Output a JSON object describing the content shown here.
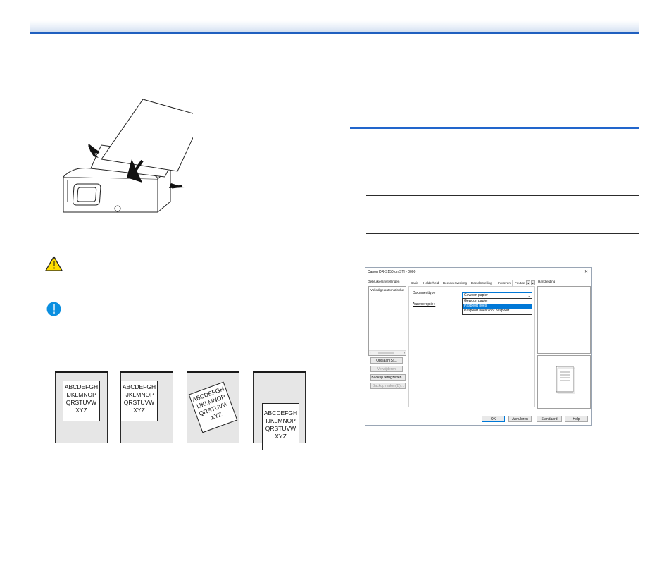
{
  "samples": {
    "lines": [
      "ABCDEFGH",
      "IJKLMNOP",
      "QRSTUVW",
      "XYZ"
    ]
  },
  "dialog": {
    "title": "Canon DR-S150 on STI - 0000",
    "close_glyph": "✕",
    "left_label": "Gebruikersinstellingen :",
    "list_item": "Volledige automatische",
    "save_btn": "Opslaan(S)...",
    "delete_btn": "Verwijderen",
    "backup_load_btn": "Backup terugzetten...",
    "backup_make_btn": "Backup maken(B)...",
    "tabs": [
      "Basis",
      "Helderheid",
      "Beeldverwerking",
      "Beeldinstelling",
      "Invoeren",
      "Foutde"
    ],
    "active_tab": "Invoeren",
    "doc_type_label": "Documenttype :",
    "doc_type_value": "Gewoon papier",
    "feed_label": "Aanvoeroptie :",
    "options": [
      "Gewoon papier",
      "Paspoort hoes",
      "Paspoort hoes voor paspoort"
    ],
    "selected_option": "Paspoort hoes",
    "help_label": "Handleiding",
    "ok": "OK",
    "cancel": "Annuleren",
    "default": "Standaard",
    "help": "Help",
    "accent": "#0078d7"
  },
  "icons": {
    "warning": "warning-icon",
    "info": "info-icon"
  }
}
